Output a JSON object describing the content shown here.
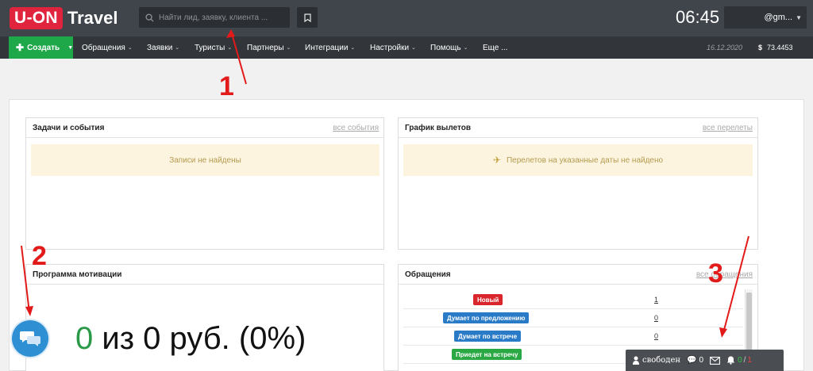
{
  "header": {
    "logo_box": "U-ON",
    "logo_text": "Travel",
    "search_placeholder": "Найти лид, заявку, клиента ...",
    "clock": "06:45",
    "user": "@gm..."
  },
  "nav": {
    "create_label": "Создать",
    "items": [
      "Обращения",
      "Заявки",
      "Туристы",
      "Партнеры",
      "Интеграции",
      "Настройки",
      "Помощь",
      "Еще ..."
    ],
    "date": "16.12.2020",
    "currency_symbol": "$",
    "rate": "73.4453"
  },
  "panels": {
    "tasks": {
      "title": "Задачи и события",
      "link": "все события",
      "empty": "Записи не найдены"
    },
    "flights": {
      "title": "График вылетов",
      "link": "все перелеты",
      "empty": "Перелетов на указанные даты не найдено"
    },
    "motivation": {
      "title": "Программа мотивации",
      "value": "0",
      "rest": " из 0 руб. (0%)"
    },
    "requests": {
      "title": "Обращения",
      "link": "все обращения",
      "rows": [
        {
          "status": "Новый",
          "count": "1",
          "color": "#d9262c"
        },
        {
          "status": "Думает по предложению",
          "count": "0",
          "color": "#2a7bc7"
        },
        {
          "status": "Думает по встрече",
          "count": "0",
          "color": "#2a7bc7"
        },
        {
          "status": "Приедет на встречу",
          "count": "",
          "color": "#2aa844"
        }
      ]
    }
  },
  "statusbar": {
    "status": "свободен",
    "messages": "0",
    "notif_green": "0",
    "notif_sep": "/",
    "notif_red": "1"
  },
  "annotations": {
    "a1": "1",
    "a2": "2",
    "a3": "3"
  },
  "colors": {
    "topbar": "#40454c",
    "navbar": "#32363b",
    "create": "#1fa84a",
    "logo": "#e0243d",
    "annotation": "#e21a1a"
  }
}
